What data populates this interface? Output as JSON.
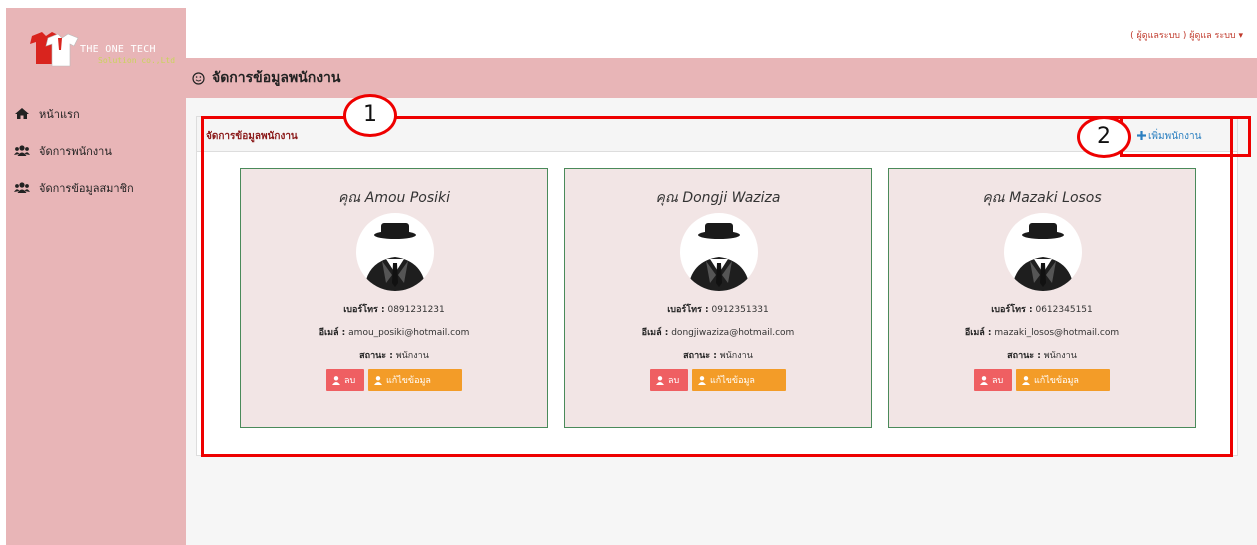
{
  "brand": {
    "title": "THE ONE TECH",
    "subtitle": "Solution co.,Ltd"
  },
  "sidebar": {
    "items": [
      {
        "label": "หน้าแรก",
        "icon": "home-icon"
      },
      {
        "label": "จัดการพนักงาน",
        "icon": "users-icon"
      },
      {
        "label": "จัดการข้อมูลสมาชิก",
        "icon": "users-icon"
      }
    ]
  },
  "topbar": {
    "user_menu": "( ผู้ดูแลระบบ ) ผู้ดูแล ระบบ ▾"
  },
  "header": {
    "title": "จัดการข้อมูลพนักงาน",
    "icon": "smile-icon"
  },
  "panel": {
    "title": "จัดการข้อมูลพนักงาน",
    "add_label": "เพิ่มพนักงาน"
  },
  "annotations": {
    "one": "1",
    "two": "2"
  },
  "labels": {
    "phone": "เบอร์โทร :",
    "email": "อีเมล์ :",
    "status": "สถานะ :",
    "delete": "ลบ",
    "edit": "แก้ไขข้อมูล"
  },
  "employees": [
    {
      "name": "คุณ Amou Posiki",
      "phone": "0891231231",
      "email": "amou_posiki@hotmail.com",
      "status": "พนักงาน"
    },
    {
      "name": "คุณ Dongji Waziza",
      "phone": "0912351331",
      "email": "dongjiwaziza@hotmail.com",
      "status": "พนักงาน"
    },
    {
      "name": "คุณ Mazaki Losos",
      "phone": "0612345151",
      "email": "mazaki_losos@hotmail.com",
      "status": "พนักงาน"
    }
  ],
  "colors": {
    "sidebar": "#e8b5b7",
    "accent_red": "#ee0000",
    "delete": "#ef5f62",
    "edit": "#f39c28",
    "card_bg": "#f2e5e5"
  }
}
